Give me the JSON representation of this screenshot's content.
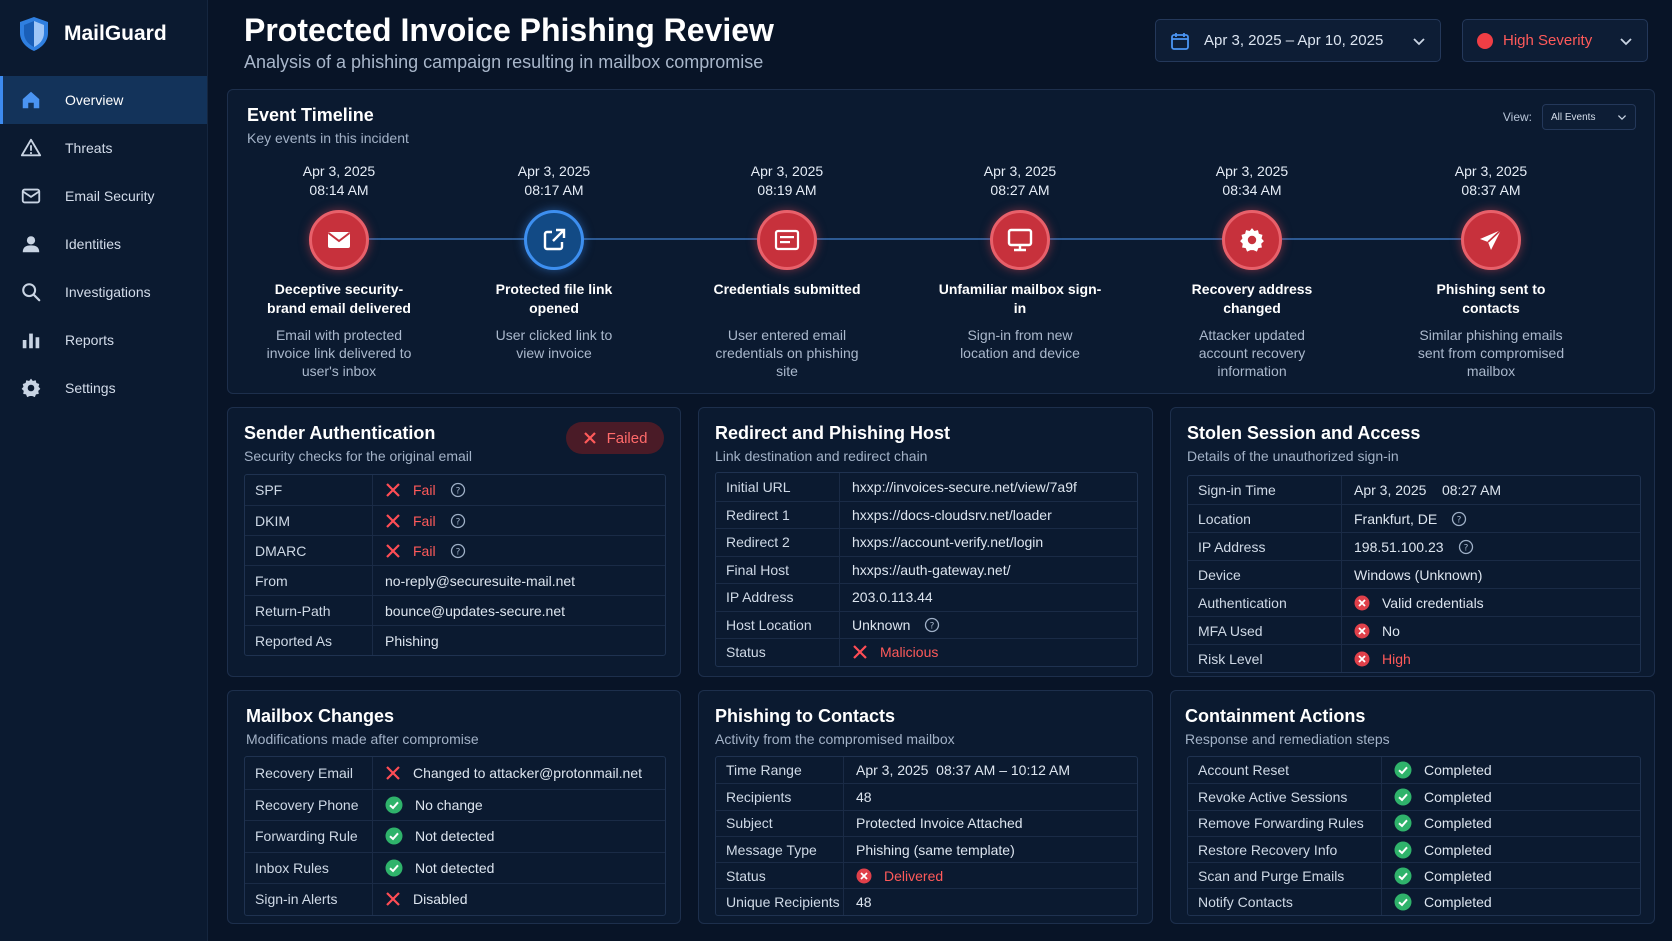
{
  "app": {
    "name": "MailGuard"
  },
  "sidebar": {
    "items": [
      {
        "label": "Overview",
        "icon": "home-icon",
        "active": true
      },
      {
        "label": "Threats",
        "icon": "warning-icon"
      },
      {
        "label": "Email Security",
        "icon": "mail-icon"
      },
      {
        "label": "Identities",
        "icon": "user-icon"
      },
      {
        "label": "Investigations",
        "icon": "search-icon"
      },
      {
        "label": "Reports",
        "icon": "bar-chart-icon"
      },
      {
        "label": "Settings",
        "icon": "gear-icon"
      }
    ]
  },
  "header": {
    "title": "Protected Invoice Phishing Review",
    "subtitle": "Analysis of a phishing campaign resulting in mailbox compromise",
    "date_range": "Apr 3, 2025 – Apr 10, 2025",
    "severity": "High Severity"
  },
  "colors": {
    "accent": "#3d8bf0",
    "danger": "#ef3e45",
    "success": "#2fb36b",
    "background": "#081427"
  },
  "timeline": {
    "title": "Event Timeline",
    "subtitle": "Key events in this incident",
    "view_label": "View:",
    "view_value": "All Events",
    "events": [
      {
        "date": "Apr 3, 2025",
        "time": "08:14 AM",
        "title": "Deceptive security-brand email delivered",
        "desc": "Email with protected invoice link delivered to user's inbox",
        "icon": "envelope-icon",
        "color": "red"
      },
      {
        "date": "Apr 3, 2025",
        "time": "08:17 AM",
        "title": "Protected file link opened",
        "desc": "User clicked link to view invoice",
        "icon": "external-link-icon",
        "color": "blue"
      },
      {
        "date": "Apr 3, 2025",
        "time": "08:19 AM",
        "title": "Credentials submitted",
        "desc": "User entered email credentials on phishing site",
        "icon": "form-icon",
        "color": "red"
      },
      {
        "date": "Apr 3, 2025",
        "time": "08:27 AM",
        "title": "Unfamiliar mailbox sign-in",
        "desc": "Sign-in from new location and device",
        "icon": "monitor-icon",
        "color": "red"
      },
      {
        "date": "Apr 3, 2025",
        "time": "08:34 AM",
        "title": "Recovery address changed",
        "desc": "Attacker updated account recovery information",
        "icon": "gear-icon",
        "color": "red"
      },
      {
        "date": "Apr 3, 2025",
        "time": "08:37 AM",
        "title": "Phishing sent to contacts",
        "desc": "Similar phishing emails sent from compromised mailbox",
        "icon": "paper-plane-icon",
        "color": "red"
      }
    ]
  },
  "sender_auth": {
    "title": "Sender Authentication",
    "subtitle": "Security checks for the original email",
    "badge": "Failed",
    "rows": [
      {
        "key": "SPF",
        "value": "Fail",
        "status": "fail",
        "help": true
      },
      {
        "key": "DKIM",
        "value": "Fail",
        "status": "fail",
        "help": true
      },
      {
        "key": "DMARC",
        "value": "Fail",
        "status": "fail",
        "help": true
      },
      {
        "key": "From",
        "value": "no-reply@securesuite-mail.net"
      },
      {
        "key": "Return-Path",
        "value": "bounce@updates-secure.net"
      },
      {
        "key": "Reported As",
        "value": "Phishing"
      }
    ]
  },
  "redirect": {
    "title": "Redirect and Phishing Host",
    "subtitle": "Link destination and redirect chain",
    "rows": [
      {
        "key": "Initial URL",
        "value": "hxxp://invoices-secure.net/view/7a9f"
      },
      {
        "key": "Redirect 1",
        "value": "hxxps://docs-cloudsrv.net/loader"
      },
      {
        "key": "Redirect 2",
        "value": "hxxps://account-verify.net/login"
      },
      {
        "key": "Final Host",
        "value": "hxxps://auth-gateway.net/"
      },
      {
        "key": "IP Address",
        "value": "203.0.113.44"
      },
      {
        "key": "Host Location",
        "value": "Unknown",
        "help": true
      },
      {
        "key": "Status",
        "value": "Malicious",
        "status": "fail"
      }
    ]
  },
  "session": {
    "title": "Stolen Session and Access",
    "subtitle": "Details of the unauthorized sign-in",
    "rows": [
      {
        "key": "Sign-in Time",
        "value": "Apr 3, 2025    08:27 AM"
      },
      {
        "key": "Location",
        "value": "Frankfurt, DE",
        "help": true
      },
      {
        "key": "IP Address",
        "value": "198.51.100.23",
        "help": true
      },
      {
        "key": "Device",
        "value": "Windows (Unknown)"
      },
      {
        "key": "Authentication",
        "value": "Valid credentials",
        "status": "bad"
      },
      {
        "key": "MFA Used",
        "value": "No",
        "status": "bad"
      },
      {
        "key": "Risk Level",
        "value": "High",
        "status": "bad",
        "red": true
      }
    ]
  },
  "mailbox": {
    "title": "Mailbox Changes",
    "subtitle": "Modifications made after compromise",
    "rows": [
      {
        "key": "Recovery Email",
        "value": "Changed to attacker@protonmail.net",
        "status": "fail"
      },
      {
        "key": "Recovery Phone",
        "value": "No change",
        "status": "ok"
      },
      {
        "key": "Forwarding Rule",
        "value": "Not detected",
        "status": "ok"
      },
      {
        "key": "Inbox Rules",
        "value": "Not detected",
        "status": "ok"
      },
      {
        "key": "Sign-in Alerts",
        "value": "Disabled",
        "status": "fail"
      }
    ]
  },
  "contacts": {
    "title": "Phishing to Contacts",
    "subtitle": "Activity from the compromised mailbox",
    "rows": [
      {
        "key": "Time Range",
        "value": "Apr 3, 2025  08:37 AM – 10:12 AM"
      },
      {
        "key": "Recipients",
        "value": "48"
      },
      {
        "key": "Subject",
        "value": "Protected Invoice Attached"
      },
      {
        "key": "Message Type",
        "value": "Phishing (same template)"
      },
      {
        "key": "Status",
        "value": "Delivered",
        "status": "bad",
        "red": true
      },
      {
        "key": "Unique Recipients",
        "value": "48"
      }
    ]
  },
  "containment": {
    "title": "Containment Actions",
    "subtitle": "Response and remediation steps",
    "rows": [
      {
        "key": "Account Reset",
        "value": "Completed",
        "status": "ok"
      },
      {
        "key": "Revoke Active Sessions",
        "value": "Completed",
        "status": "ok"
      },
      {
        "key": "Remove Forwarding Rules",
        "value": "Completed",
        "status": "ok"
      },
      {
        "key": "Restore Recovery Info",
        "value": "Completed",
        "status": "ok"
      },
      {
        "key": "Scan and Purge Emails",
        "value": "Completed",
        "status": "ok"
      },
      {
        "key": "Notify Contacts",
        "value": "Completed",
        "status": "ok"
      }
    ]
  }
}
